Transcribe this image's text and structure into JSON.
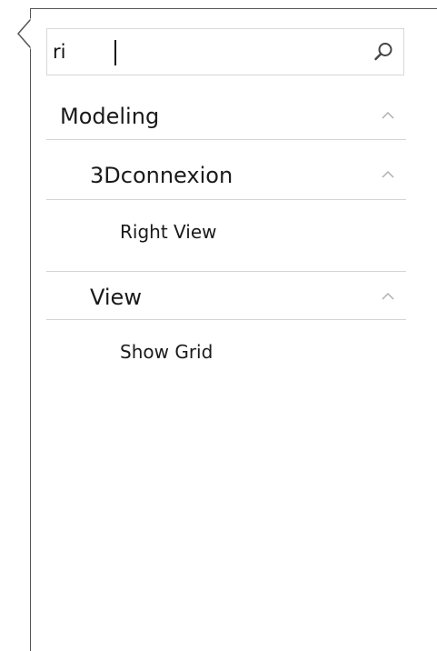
{
  "search": {
    "value": "ri",
    "placeholder": ""
  },
  "tree": {
    "group_modeling": {
      "label": "Modeling",
      "expanded": true
    },
    "group_3dconnexion": {
      "label": "3Dconnexion",
      "expanded": true
    },
    "cmd_right_view": {
      "label": "Right View"
    },
    "group_view": {
      "label": "View",
      "expanded": true
    },
    "cmd_show_grid": {
      "label": "Show Grid"
    }
  },
  "icons": {
    "search": "search-icon",
    "collapse": "chevron-up-icon"
  },
  "colors": {
    "border": "#555555",
    "divider": "#d4d4d4",
    "chevron": "#b0b0b0",
    "text": "#1a1a1a"
  }
}
